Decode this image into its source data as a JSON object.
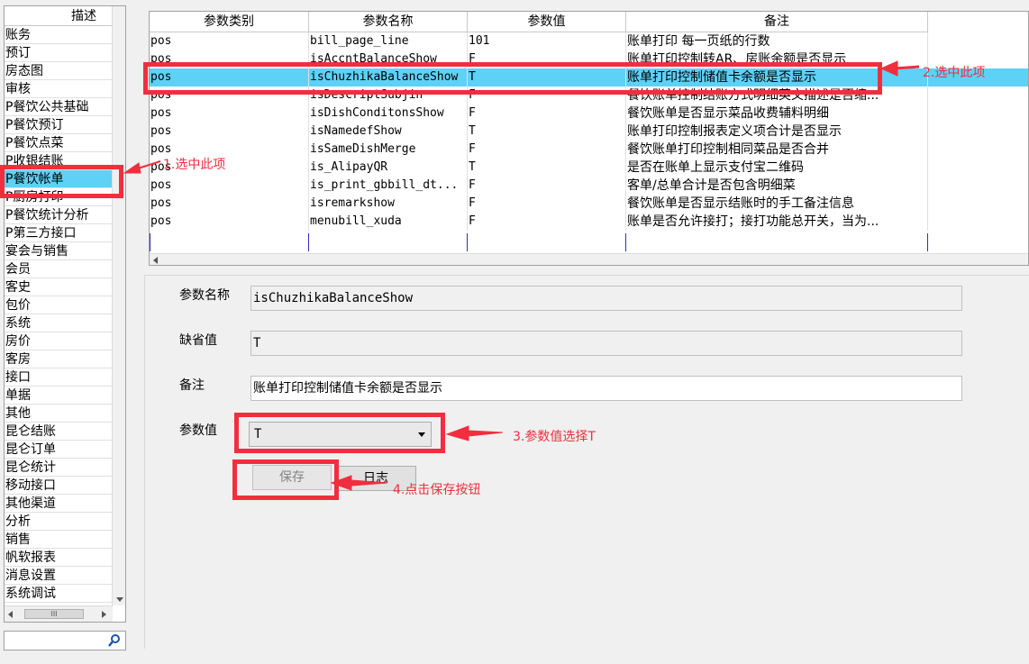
{
  "sidebar": {
    "header": "描述",
    "items": [
      {
        "label": "账务"
      },
      {
        "label": "预订"
      },
      {
        "label": "房态图"
      },
      {
        "label": "审核"
      },
      {
        "label": "P餐饮公共基础"
      },
      {
        "label": "P餐饮预订"
      },
      {
        "label": "P餐饮点菜"
      },
      {
        "label": "P收银结账"
      },
      {
        "label": "P餐饮帐单"
      },
      {
        "label": "P厨房打印"
      },
      {
        "label": "P餐饮统计分析"
      },
      {
        "label": "P第三方接口"
      },
      {
        "label": "宴会与销售"
      },
      {
        "label": "会员"
      },
      {
        "label": "客史"
      },
      {
        "label": "包价"
      },
      {
        "label": "系统"
      },
      {
        "label": "房价"
      },
      {
        "label": "客房"
      },
      {
        "label": "接口"
      },
      {
        "label": "单据"
      },
      {
        "label": "其他"
      },
      {
        "label": "昆仑结账"
      },
      {
        "label": "昆仑订单"
      },
      {
        "label": "昆仑统计"
      },
      {
        "label": "移动接口"
      },
      {
        "label": "其他渠道"
      },
      {
        "label": "分析"
      },
      {
        "label": "销售"
      },
      {
        "label": "帆软报表"
      },
      {
        "label": "消息设置"
      },
      {
        "label": "系统调试"
      }
    ],
    "selected_index": 8,
    "hscroll_grip": "III"
  },
  "grid": {
    "columns": [
      "参数类别",
      "参数名称",
      "参数值",
      "备注"
    ],
    "rows": [
      {
        "category": "pos",
        "name": "bill_page_line",
        "value": "101",
        "remark": "账单打印 每一页纸的行数"
      },
      {
        "category": "pos",
        "name": "isAccntBalanceShow",
        "value": "F",
        "remark": "账单打印控制转AR、房账余额是否显示"
      },
      {
        "category": "pos",
        "name": "isChuzhikaBalanceShow",
        "value": "T",
        "remark": "账单打印控制储值卡余额是否显示"
      },
      {
        "category": "pos",
        "name": "isDescriptSubjin",
        "value": "F",
        "remark": "餐饮账单控制结账方式明细英文描述是否缩..."
      },
      {
        "category": "pos",
        "name": "isDishConditonsShow",
        "value": "F",
        "remark": "餐饮账单是否显示菜品收费辅料明细"
      },
      {
        "category": "pos",
        "name": "isNamedefShow",
        "value": "T",
        "remark": "账单打印控制报表定义项合计是否显示"
      },
      {
        "category": "pos",
        "name": "isSameDishMerge",
        "value": "F",
        "remark": "餐饮账单打印控制相同菜品是否合并"
      },
      {
        "category": "pos",
        "name": "is_AlipayQR",
        "value": "T",
        "remark": "是否在账单上显示支付宝二维码"
      },
      {
        "category": "pos",
        "name": "is_print_gbbill_dt...",
        "value": "F",
        "remark": "客单/总单合计是否包含明细菜"
      },
      {
        "category": "pos",
        "name": "isremarkshow",
        "value": "F",
        "remark": "餐饮账单是否显示结账时的手工备注信息"
      },
      {
        "category": "pos",
        "name": "menubill_xuda",
        "value": "F",
        "remark": "账单是否允许接打；接打功能总开关，当为..."
      }
    ],
    "selected_index": 2
  },
  "detail": {
    "name_label": "参数名称",
    "name_value": "isChuzhikaBalanceShow",
    "default_label": "缺省值",
    "default_value": "T",
    "remark_label": "备注",
    "remark_value": "账单打印控制储值卡余额是否显示",
    "value_label": "参数值",
    "value_selected": "T",
    "save_label": "保存",
    "log_label": "日志"
  },
  "annotations": {
    "step1": "1.选中此项",
    "step2": "2.选中此项",
    "step3": "3.参数值选择T",
    "step4": "4.点击保存按钮",
    "color": "#f12e3e"
  },
  "colors": {
    "selection": "#5ed1f7",
    "background": "#f0f0f0"
  }
}
